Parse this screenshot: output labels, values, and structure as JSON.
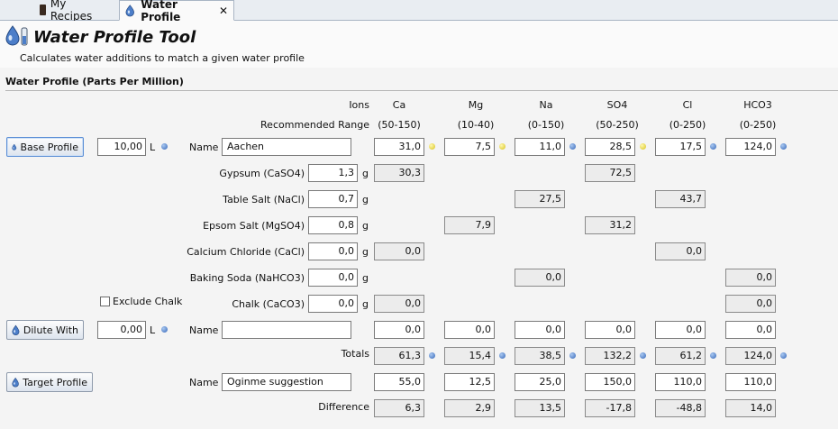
{
  "tabs": [
    {
      "label": "My Recipes",
      "active": false
    },
    {
      "label": "Water Profile",
      "active": true
    }
  ],
  "header": {
    "title": "Water Profile Tool",
    "subtitle": "Calculates water additions to match a given water profile"
  },
  "section_title": "Water Profile (Parts Per Million)",
  "ion_labels": {
    "ions": "Ions",
    "recommended": "Recommended Range"
  },
  "ions": [
    "Ca",
    "Mg",
    "Na",
    "SO4",
    "Cl",
    "HCO3"
  ],
  "ranges": [
    "(50-150)",
    "(10-40)",
    "(0-150)",
    "(50-250)",
    "(0-250)",
    "(0-250)"
  ],
  "base": {
    "button": "Base Profile",
    "volume": "10,00",
    "unit": "L",
    "name_label": "Name",
    "name": "Aachen",
    "values": [
      "31,0",
      "7,5",
      "11,0",
      "28,5",
      "17,5",
      "124,0"
    ],
    "status": [
      "yellow",
      "yellow",
      "blue",
      "yellow",
      "blue",
      "blue"
    ]
  },
  "additions": [
    {
      "label": "Gypsum (CaSO4)",
      "amount": "1,3",
      "unit": "g",
      "values": {
        "Ca": "30,3",
        "SO4": "72,5"
      }
    },
    {
      "label": "Table Salt (NaCl)",
      "amount": "0,7",
      "unit": "g",
      "values": {
        "Na": "27,5",
        "Cl": "43,7"
      }
    },
    {
      "label": "Epsom Salt (MgSO4)",
      "amount": "0,8",
      "unit": "g",
      "values": {
        "Mg": "7,9",
        "SO4": "31,2"
      }
    },
    {
      "label": "Calcium Chloride (CaCl)",
      "amount": "0,0",
      "unit": "g",
      "values": {
        "Ca": "0,0",
        "Cl": "0,0"
      }
    },
    {
      "label": "Baking Soda (NaHCO3)",
      "amount": "0,0",
      "unit": "g",
      "values": {
        "Na": "0,0",
        "HCO3": "0,0"
      }
    },
    {
      "label": "Chalk (CaCO3)",
      "amount": "0,0",
      "unit": "g",
      "values": {
        "Ca": "0,0",
        "HCO3": "0,0"
      }
    }
  ],
  "exclude_chalk": {
    "label": "Exclude Chalk",
    "checked": false
  },
  "dilute": {
    "button": "Dilute With",
    "volume": "0,00",
    "unit": "L",
    "name_label": "Name",
    "name": "",
    "values": [
      "0,0",
      "0,0",
      "0,0",
      "0,0",
      "0,0",
      "0,0"
    ]
  },
  "totals": {
    "label": "Totals",
    "values": [
      "61,3",
      "15,4",
      "38,5",
      "132,2",
      "61,2",
      "124,0"
    ],
    "status": [
      "blue",
      "blue",
      "blue",
      "blue",
      "blue",
      "blue"
    ]
  },
  "target": {
    "button": "Target Profile",
    "name_label": "Name",
    "name": "Oginme suggestion",
    "values": [
      "55,0",
      "12,5",
      "25,0",
      "150,0",
      "110,0",
      "110,0"
    ]
  },
  "difference": {
    "label": "Difference",
    "values": [
      "6,3",
      "2,9",
      "13,5",
      "-17,8",
      "-48,8",
      "14,0"
    ]
  },
  "colors": {
    "status_blue": "#3566b9",
    "status_yellow": "#d8c21a",
    "drop_icon": "#2f5fa8"
  }
}
